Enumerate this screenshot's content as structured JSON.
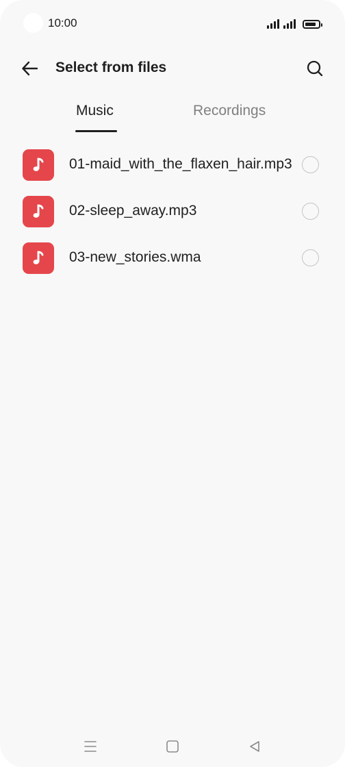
{
  "status_bar": {
    "time": "10:00",
    "battery_level": 0.85,
    "signal_1_bars": 4,
    "signal_2_bars": 4
  },
  "header": {
    "title": "Select from files",
    "back_icon": "arrow-left-icon",
    "search_icon": "search-icon"
  },
  "tabs": [
    {
      "label": "Music",
      "active": true
    },
    {
      "label": "Recordings",
      "active": false
    }
  ],
  "files": [
    {
      "name": "01-maid_with_the_flaxen_hair.mp3",
      "icon": "music-note-icon",
      "selected": false
    },
    {
      "name": "02-sleep_away.mp3",
      "icon": "music-note-icon",
      "selected": false
    },
    {
      "name": "03-new_stories.wma",
      "icon": "music-note-icon",
      "selected": false
    }
  ],
  "nav_bar": {
    "menu_icon": "menu-icon",
    "home_icon": "home-icon",
    "back_icon": "back-triangle-icon"
  },
  "colors": {
    "background": "#f8f8f8",
    "file_icon_bg": "#e5464b",
    "active_tab": "#1f1f1f",
    "inactive_tab": "#808080"
  }
}
